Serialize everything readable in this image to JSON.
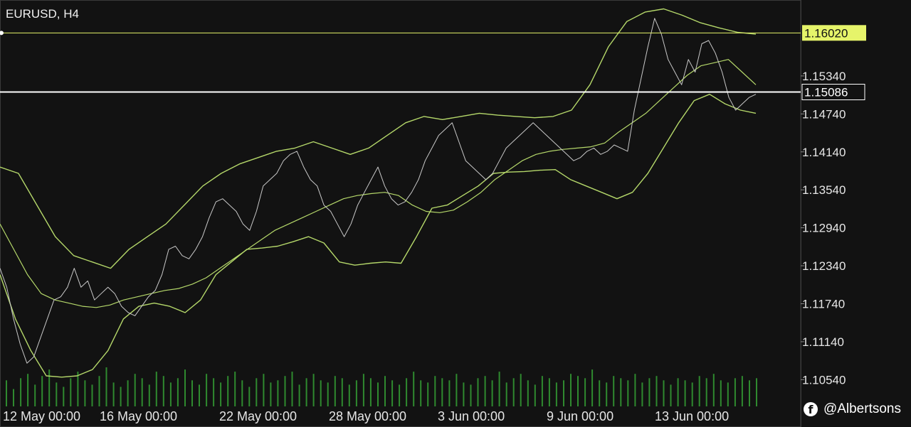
{
  "header": {
    "symbol_title": "EURUSD, H4"
  },
  "watermark": {
    "icon": "facebook-icon",
    "handle": "@Albertsons"
  },
  "colors": {
    "background": "#121212",
    "price_line": "#c8c8c8",
    "bands": "#b5d86a",
    "highlight_label": "#e6f46a",
    "volume": "#2f8a2f",
    "axis_text": "#e6e6e6",
    "current_line": "#ffffff"
  },
  "chart_data": {
    "type": "line",
    "xlabel": "",
    "ylabel": "",
    "ylim": [
      1.1014,
      1.1654
    ],
    "x_ticks": [
      "12 May 00:00",
      "16 May 00:00",
      "22 May 00:00",
      "28 May 00:00",
      "3 Jun 00:00",
      "9 Jun 00:00",
      "13 Jun 00:00"
    ],
    "y_ticks": [
      "1.10540",
      "1.11140",
      "1.11740",
      "1.12340",
      "1.12940",
      "1.13540",
      "1.14140",
      "1.14740",
      "1.15340"
    ],
    "horizontal_lines": [
      {
        "label": "1.16020",
        "value": 1.1602,
        "style": "highlight"
      },
      {
        "label": "1.15086",
        "value": 1.15086,
        "style": "current"
      }
    ],
    "series": [
      {
        "values": [
          1.123,
          1.12,
          1.115,
          1.111,
          1.108,
          1.109,
          1.112,
          1.115,
          1.118,
          1.1185,
          1.12,
          1.123,
          1.12,
          1.121,
          1.118,
          1.119,
          1.12,
          1.119,
          1.117,
          1.116,
          1.1155,
          1.117,
          1.1185,
          1.1195,
          1.122,
          1.126,
          1.1265,
          1.125,
          1.1245,
          1.126,
          1.128,
          1.131,
          1.1335,
          1.134,
          1.133,
          1.132,
          1.13,
          1.129,
          1.132,
          1.136,
          1.137,
          1.138,
          1.14,
          1.141,
          1.1415,
          1.139,
          1.137,
          1.136,
          1.133,
          1.132,
          1.13,
          1.128,
          1.13,
          1.133,
          1.135,
          1.137,
          1.139,
          1.136,
          1.134,
          1.133,
          1.1335,
          1.135,
          1.137,
          1.14,
          1.142,
          1.144,
          1.145,
          1.146,
          1.143,
          1.14,
          1.139,
          1.138,
          1.137,
          1.138,
          1.14,
          1.142,
          1.143,
          1.144,
          1.145,
          1.146,
          1.145,
          1.144,
          1.143,
          1.142,
          1.141,
          1.14,
          1.1405,
          1.1415,
          1.142,
          1.141,
          1.1415,
          1.1425,
          1.142,
          1.1415,
          1.148,
          1.153,
          1.158,
          1.1625,
          1.16,
          1.156,
          1.154,
          1.152,
          1.156,
          1.154,
          1.1585,
          1.159,
          1.157,
          1.154,
          1.15,
          1.148,
          1.149,
          1.15,
          1.1505
        ]
      },
      {
        "values": [
          1.13,
          1.126,
          1.122,
          1.119,
          1.118,
          1.1175,
          1.117,
          1.1168,
          1.1172,
          1.118,
          1.1185,
          1.119,
          1.1195,
          1.1198,
          1.1205,
          1.1215,
          1.123,
          1.1245,
          1.126,
          1.1275,
          1.129,
          1.13,
          1.131,
          1.132,
          1.133,
          1.134,
          1.1345,
          1.1348,
          1.135,
          1.1345,
          1.133,
          1.132,
          1.1318,
          1.1322,
          1.1335,
          1.135,
          1.137,
          1.1385,
          1.14,
          1.141,
          1.1415,
          1.1418,
          1.142,
          1.1422,
          1.1428,
          1.1445,
          1.146,
          1.1475,
          1.1495,
          1.1515,
          1.1535,
          1.155,
          1.1555,
          1.156,
          1.154,
          1.152
        ]
      },
      {
        "values": [
          1.139,
          1.138,
          1.133,
          1.128,
          1.125,
          1.124,
          1.123,
          1.126,
          1.128,
          1.13,
          1.133,
          1.136,
          1.138,
          1.1395,
          1.1405,
          1.1415,
          1.142,
          1.143,
          1.142,
          1.141,
          1.142,
          1.144,
          1.146,
          1.147,
          1.1465,
          1.147,
          1.1475,
          1.1472,
          1.147,
          1.1468,
          1.147,
          1.148,
          1.152,
          1.158,
          1.162,
          1.1635,
          1.164,
          1.163,
          1.1618,
          1.161,
          1.1603,
          1.16
        ]
      },
      {
        "values": [
          1.122,
          1.115,
          1.11,
          1.106,
          1.1058,
          1.106,
          1.107,
          1.11,
          1.115,
          1.117,
          1.1175,
          1.117,
          1.116,
          1.118,
          1.122,
          1.124,
          1.126,
          1.1262,
          1.1265,
          1.1272,
          1.128,
          1.127,
          1.124,
          1.1235,
          1.1238,
          1.124,
          1.1238,
          1.128,
          1.1325,
          1.133,
          1.1345,
          1.136,
          1.138,
          1.1382,
          1.1383,
          1.1385,
          1.1386,
          1.137,
          1.136,
          1.135,
          1.134,
          1.135,
          1.138,
          1.142,
          1.146,
          1.1495,
          1.1505,
          1.149,
          1.148,
          1.1475
        ]
      },
      {
        "type": "bar",
        "values": [
          12,
          8,
          13,
          15,
          10,
          14,
          17,
          11,
          9,
          13,
          16,
          12,
          10,
          14,
          18,
          11,
          9,
          12,
          15,
          13,
          10,
          16,
          14,
          11,
          13,
          17,
          12,
          10,
          15,
          13,
          11,
          14,
          16,
          12,
          9,
          13,
          15,
          11,
          12,
          14,
          16,
          10,
          13,
          15,
          12,
          11,
          14,
          13,
          10,
          12,
          15,
          13,
          11,
          14,
          12,
          10,
          13,
          16,
          12,
          11,
          14,
          13,
          12,
          15,
          11,
          10,
          13,
          14,
          12,
          16,
          11,
          13,
          15,
          12,
          10,
          14,
          13,
          11,
          12,
          15,
          14,
          13,
          17,
          12,
          11,
          14,
          13,
          12,
          15,
          11,
          13,
          14,
          12,
          10,
          13,
          12,
          11,
          14,
          13,
          15,
          12,
          11,
          13,
          14,
          12,
          13
        ]
      }
    ]
  }
}
